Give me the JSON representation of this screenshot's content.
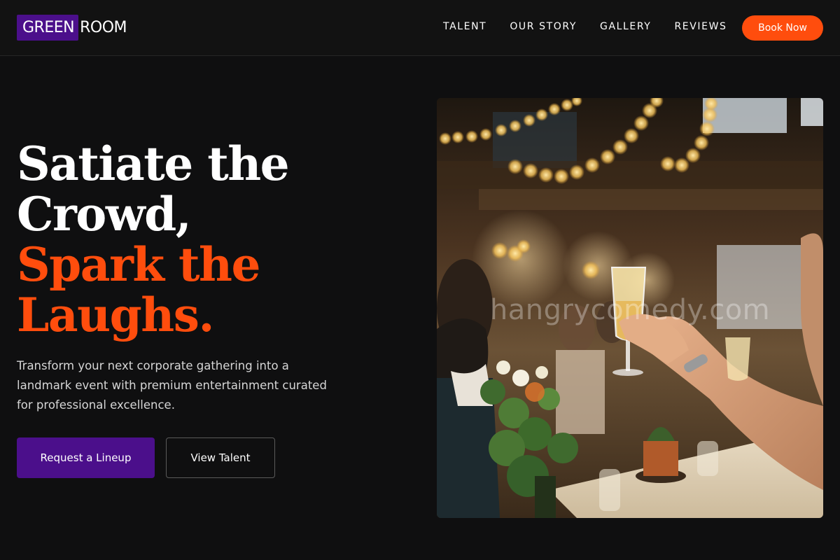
{
  "header": {
    "logo": {
      "part1": "GREEN",
      "part2": "ROOM"
    },
    "nav": [
      {
        "label": "TALENT"
      },
      {
        "label": "OUR STORY"
      },
      {
        "label": "GALLERY"
      },
      {
        "label": "REVIEWS"
      }
    ],
    "cta_label": "Book Now"
  },
  "hero": {
    "headline": {
      "line1": "Satiate the",
      "line2": "Crowd,",
      "line3": "Spark the",
      "line4": "Laughs."
    },
    "subtext": "Transform your next corporate gathering into a landmark event with premium entertainment curated for professional excellence.",
    "primary_button": "Request a Lineup",
    "secondary_button": "View Talent",
    "image": {
      "watermark": "hangrycomedy.com"
    }
  },
  "colors": {
    "background": "#0f0f10",
    "brand_purple": "#4b0f8b",
    "accent_orange": "#ff4d0d",
    "text_light": "#d6d6d6"
  },
  "icons": {
    "hero_photo": "celebration-toast-photo"
  }
}
